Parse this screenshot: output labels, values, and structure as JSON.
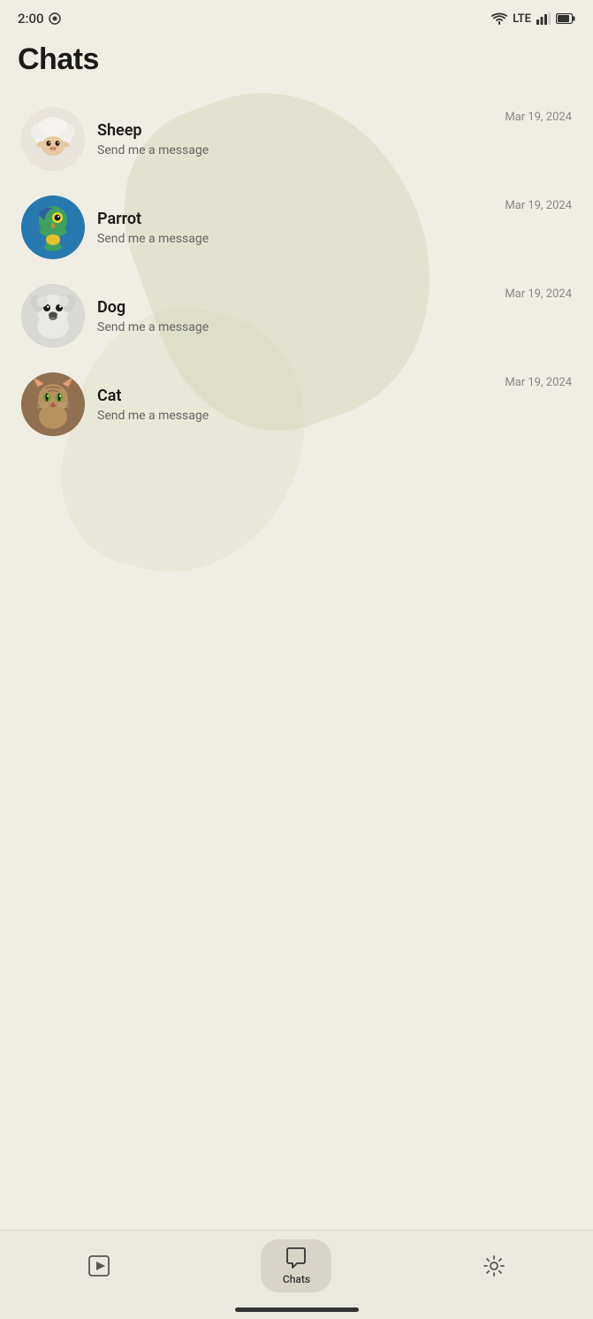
{
  "statusBar": {
    "time": "2:00",
    "lte": "LTE"
  },
  "pageTitle": "Chats",
  "chats": [
    {
      "id": "sheep",
      "name": "Sheep",
      "preview": "Send me a message",
      "date": "Mar 19, 2024",
      "avatarType": "sheep"
    },
    {
      "id": "parrot",
      "name": "Parrot",
      "preview": "Send me a message",
      "date": "Mar 19, 2024",
      "avatarType": "parrot"
    },
    {
      "id": "dog",
      "name": "Dog",
      "preview": "Send me a message",
      "date": "Mar 19, 2024",
      "avatarType": "dog"
    },
    {
      "id": "cat",
      "name": "Cat",
      "preview": "Send me a message",
      "date": "Mar 19, 2024",
      "avatarType": "cat"
    }
  ],
  "bottomNav": {
    "storiesLabel": "",
    "chatsLabel": "Chats",
    "settingsLabel": ""
  }
}
